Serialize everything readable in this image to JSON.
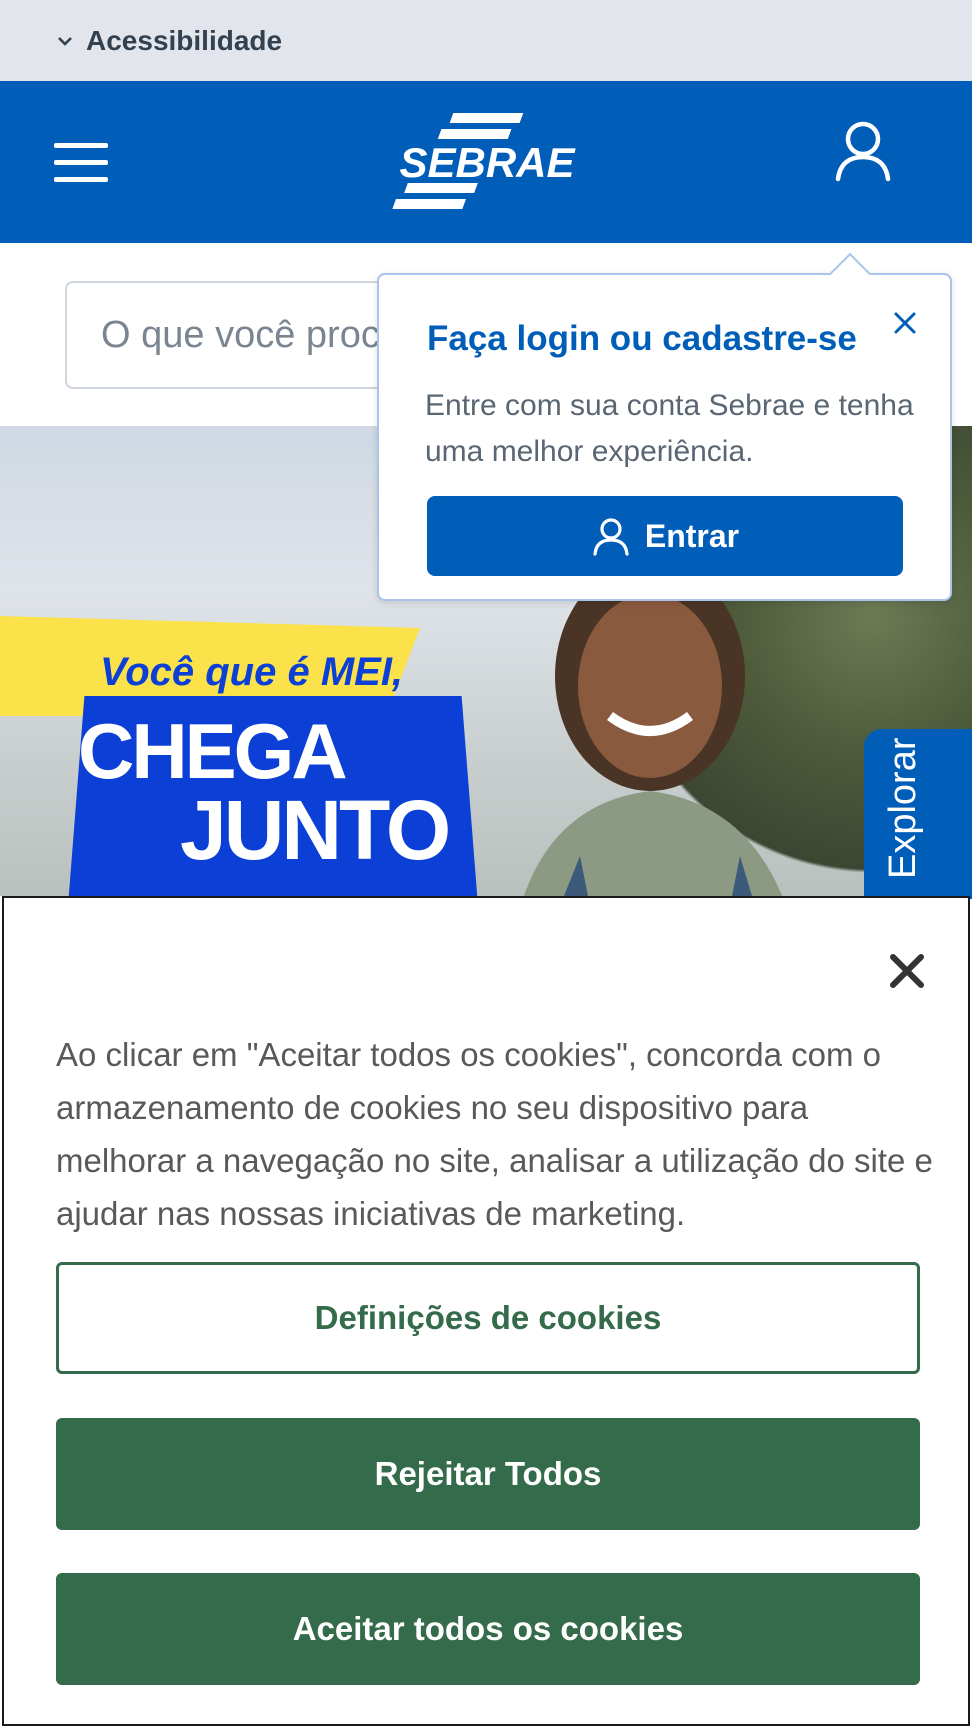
{
  "accessibility": {
    "label": "Acessibilidade",
    "icon": "chevron-down-icon"
  },
  "header": {
    "brand": "SEBRAE",
    "background": "#005eb8",
    "menu_icon": "hamburger-menu-icon",
    "user_icon": "user-icon"
  },
  "search": {
    "placeholder": "O que você procura?"
  },
  "hero": {
    "tagline": "Você que é MEI,",
    "headline_1": "CHEGA",
    "headline_2": "JUNTO",
    "explore_label": "Explorar"
  },
  "login_popover": {
    "title": "Faça login ou cadastre-se",
    "description": "Entre com sua conta Sebrae e tenha uma melhor experiência.",
    "button_label": "Entrar",
    "close_icon": "close-icon",
    "accent": "#005eb8"
  },
  "cookie_banner": {
    "text": "Ao clicar em \"Aceitar todos os cookies\", concorda com o armazenamento de cookies no seu dispositivo para melhorar a navegação no site, analisar a utilização do site e ajudar nas nossas iniciativas de marketing.",
    "settings_label": "Definições de cookies",
    "reject_label": "Rejeitar Todos",
    "accept_label": "Aceitar todos os cookies",
    "close_icon": "close-icon",
    "button_color": "#346b4a"
  }
}
